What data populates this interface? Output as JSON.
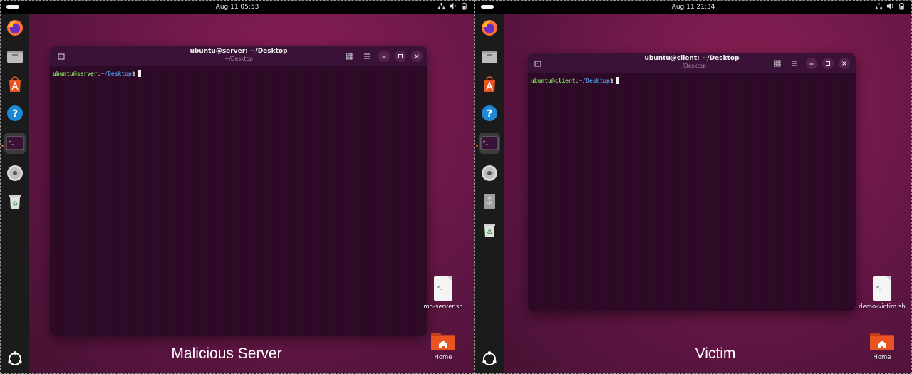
{
  "left": {
    "clock": "Aug 11  05:53",
    "window_title": "ubuntu@server: ~/Desktop",
    "window_subtitle": "~/Desktop",
    "prompt_user": "ubuntu@server",
    "prompt_sep": ":",
    "prompt_path": "~/Desktop",
    "prompt_dollar": "$",
    "desktop_file": "mo-server.sh",
    "home_label": "Home",
    "caption": "Malicious Server"
  },
  "right": {
    "clock": "Aug 11  21:34",
    "window_title": "ubuntu@client: ~/Desktop",
    "window_subtitle": "~/Desktop",
    "prompt_user": "ubuntu@client",
    "prompt_sep": ":",
    "prompt_path": "~/Desktop",
    "prompt_dollar": "$",
    "desktop_file": "demo-victim.sh",
    "home_label": "Home",
    "caption": "Victim"
  },
  "file_icon_glyph": ">_",
  "colors": {
    "ubuntu_orange": "#e95420",
    "desktop": "#741a4c",
    "terminal_bg": "#2c0a25",
    "prompt_user": "#7dd35a",
    "prompt_path": "#4e8fdd"
  },
  "dock_icons": [
    "firefox-icon",
    "files-icon",
    "app-center-icon",
    "help-icon",
    "terminal-icon",
    "disc-icon",
    "usb-drive-icon",
    "trash-icon",
    "show-apps-icon"
  ]
}
